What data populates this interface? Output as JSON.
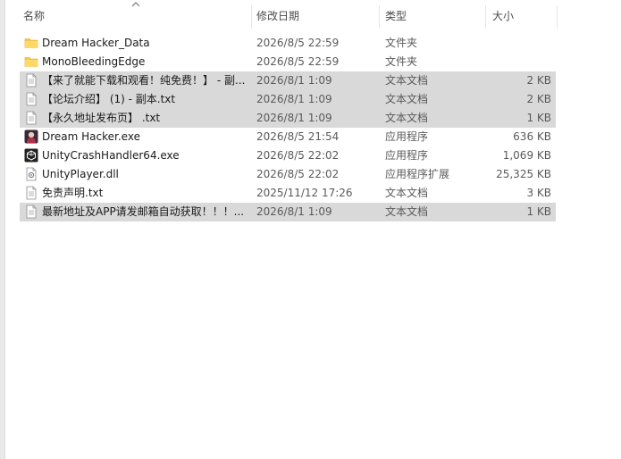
{
  "columns": {
    "name": "名称",
    "date": "修改日期",
    "type": "类型",
    "size": "大小"
  },
  "colors": {
    "folder": "#f4c84a",
    "selected_row": "#d9d9d9"
  },
  "files": [
    {
      "name": "Dream Hacker_Data",
      "date": "2026/8/5 22:59",
      "type": "文件夹",
      "size": "",
      "icon": "folder-icon",
      "selected": false
    },
    {
      "name": "MonoBleedingEdge",
      "date": "2026/8/5 22:59",
      "type": "文件夹",
      "size": "",
      "icon": "folder-icon",
      "selected": false
    },
    {
      "name": "【来了就能下载和观看！纯免费！】 - 副...",
      "date": "2026/8/1 1:09",
      "type": "文本文档",
      "size": "2 KB",
      "icon": "text-file-icon",
      "selected": true
    },
    {
      "name": "【论坛介绍】 (1) - 副本.txt",
      "date": "2026/8/1 1:09",
      "type": "文本文档",
      "size": "2 KB",
      "icon": "text-file-icon",
      "selected": true
    },
    {
      "name": "【永久地址发布页】 .txt",
      "date": "2026/8/1 1:09",
      "type": "文本文档",
      "size": "1 KB",
      "icon": "text-file-icon",
      "selected": true
    },
    {
      "name": "Dream Hacker.exe",
      "date": "2026/8/5 21:54",
      "type": "应用程序",
      "size": "636 KB",
      "icon": "game-app-icon",
      "selected": false
    },
    {
      "name": "UnityCrashHandler64.exe",
      "date": "2026/8/5 22:02",
      "type": "应用程序",
      "size": "1,069 KB",
      "icon": "unity-app-icon",
      "selected": false
    },
    {
      "name": "UnityPlayer.dll",
      "date": "2026/8/5 22:02",
      "type": "应用程序扩展",
      "size": "25,325 KB",
      "icon": "dll-file-icon",
      "selected": false
    },
    {
      "name": "免责声明.txt",
      "date": "2025/11/12 17:26",
      "type": "文本文档",
      "size": "3 KB",
      "icon": "text-file-icon",
      "selected": false
    },
    {
      "name": "最新地址及APP请发邮箱自动获取！！！...",
      "date": "2026/8/1 1:09",
      "type": "文本文档",
      "size": "1 KB",
      "icon": "text-file-icon",
      "selected": true
    }
  ]
}
